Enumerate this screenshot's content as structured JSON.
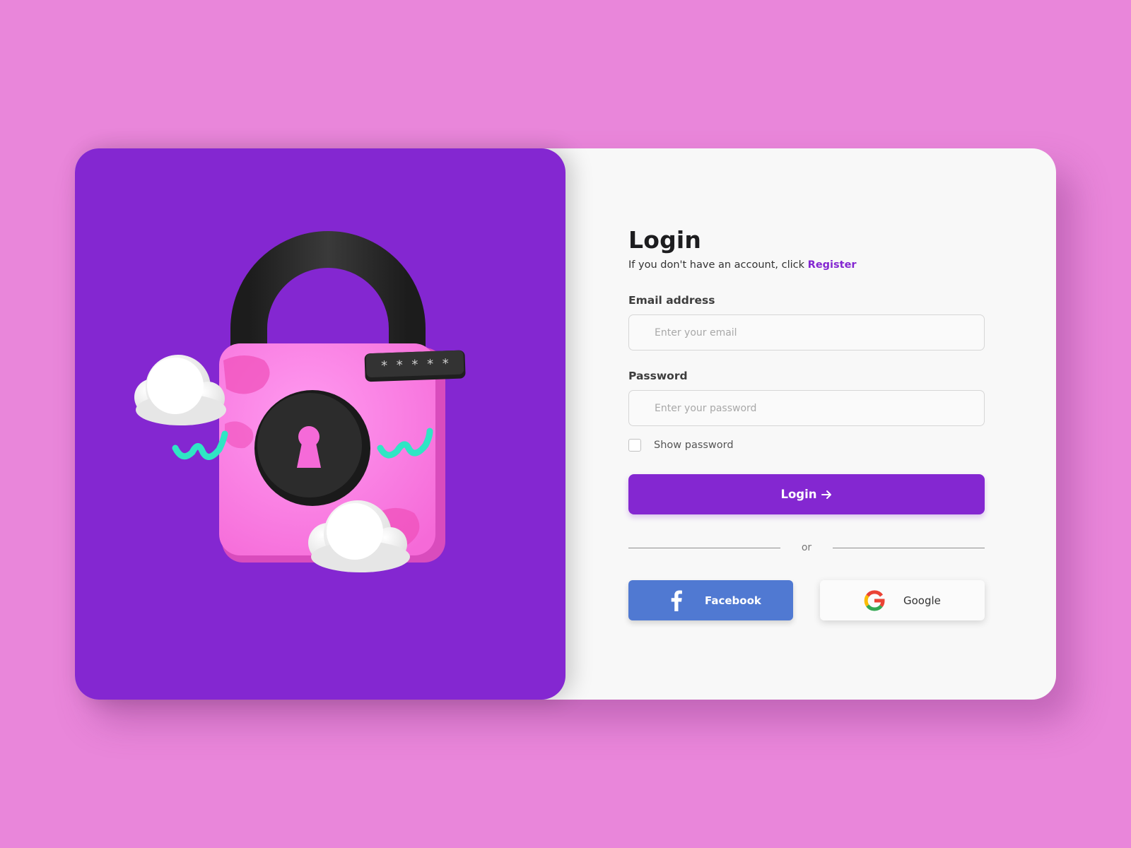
{
  "login": {
    "title": "Login",
    "subtitle_prefix": "If you don't have an account, click ",
    "register_link": "Register",
    "email_label": "Email address",
    "email_placeholder": "Enter your email",
    "password_label": "Password",
    "password_placeholder": "Enter your password",
    "show_password_label": "Show password",
    "show_password_checked": false,
    "submit_label": "Login",
    "divider_text": "or",
    "facebook_label": "Facebook",
    "google_label": "Google"
  },
  "illustration": {
    "password_tag": "* * * * *"
  },
  "colors": {
    "background": "#e986da",
    "accent": "#8427d1",
    "card": "#f8f8f8",
    "facebook": "#5079d2",
    "lock_body": "#ff80e8",
    "lock_dark": "#2a2a2a",
    "squiggle": "#2fe6c4"
  },
  "icons": {
    "submit_arrow": "arrow-right-icon",
    "facebook": "facebook-icon",
    "google": "google-icon",
    "illustration": "padlock-illustration"
  }
}
